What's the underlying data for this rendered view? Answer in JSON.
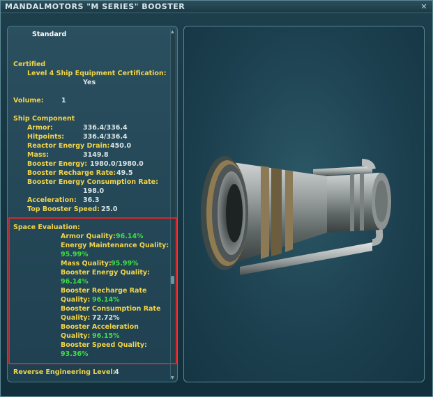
{
  "window": {
    "title": "MANDALMOTORS \"M SERIES\" BOOSTER",
    "close_symbol": "✕"
  },
  "details": {
    "type": "Standard",
    "certified_heading": "Certified",
    "certification_label": "Level 4 Ship Equipment Certification:",
    "certification_value": "Yes",
    "volume_label": "Volume:",
    "volume_value": "1",
    "ship_component_heading": "Ship Component",
    "stats": [
      {
        "label": "Armor:",
        "value": "336.4/336.4"
      },
      {
        "label": "Hitpoints:",
        "value": "336.4/336.4"
      },
      {
        "label": "Reactor Energy Drain:",
        "value": "450.0"
      },
      {
        "label": "Mass:",
        "value": "3149.8"
      },
      {
        "label": "Booster Energy:",
        "value": "1980.0/1980.0"
      },
      {
        "label": "Booster Recharge Rate:",
        "value": "49.5"
      },
      {
        "label": "Booster Energy Consumption Rate:",
        "value": "198.0"
      },
      {
        "label": "Acceleration:",
        "value": "36.3"
      },
      {
        "label": "Top Booster Speed:",
        "value": "25.0"
      }
    ],
    "space_evaluation_heading": "Space Evaluation:",
    "evaluation": {
      "armor_label": "Armor Quality:",
      "armor_value": "96.14%",
      "energy_maint_label": "Energy Maintenance Quality:",
      "energy_maint_value": "95.99%",
      "mass_label": "Mass Quality:",
      "mass_value": "95.99%",
      "booster_energy_label": "Booster Energy Quality:",
      "booster_energy_value": "96.14%",
      "recharge_label_1": "Booster Recharge Rate",
      "recharge_label_2": "Quality:",
      "recharge_value": "96.14%",
      "consumption_label_1": "Booster Consumption Rate",
      "consumption_label_2": "Quality:",
      "consumption_value": "72.72%",
      "acceleration_label_1": "Booster Acceleration",
      "acceleration_label_2": "Quality:",
      "acceleration_value": "96.15%",
      "speed_label": "Booster Speed Quality:",
      "speed_value": "93.36%"
    },
    "reverse_engineering_label": "Reverse Engineering Level:",
    "reverse_engineering_value": "4"
  },
  "colors": {
    "heading_yellow": "#f2d44a",
    "value_green": "#3fe044",
    "highlight_red": "#d9262b"
  }
}
